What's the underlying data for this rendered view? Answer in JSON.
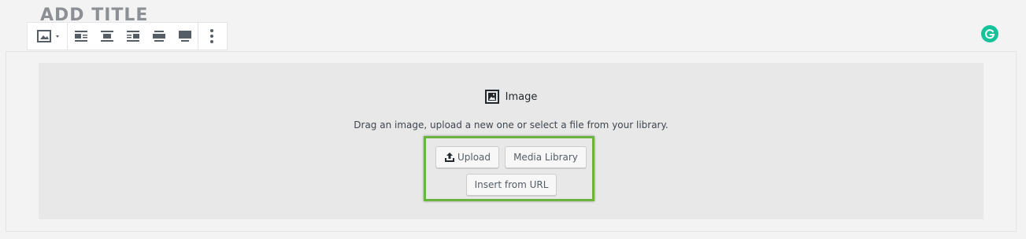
{
  "post": {
    "title": "ADD TITLE"
  },
  "toolbar": {
    "block_type_icon": "image-icon",
    "buttons": [
      {
        "name": "align-left",
        "icon": "align-left-icon"
      },
      {
        "name": "align-center",
        "icon": "align-center-icon"
      },
      {
        "name": "align-right",
        "icon": "align-right-icon"
      },
      {
        "name": "wide-width",
        "icon": "wide-width-icon"
      },
      {
        "name": "full-width",
        "icon": "full-width-icon"
      }
    ],
    "more_icon": "more-vertical-icon"
  },
  "placeholder": {
    "label": "Image",
    "instructions": "Drag an image, upload a new one or select a file from your library.",
    "upload_label": "Upload",
    "media_library_label": "Media Library",
    "insert_url_label": "Insert from URL"
  },
  "colors": {
    "highlight": "#6bb43f",
    "grammarly": "#15c39a",
    "placeholder_bg": "#e8e8e8"
  }
}
